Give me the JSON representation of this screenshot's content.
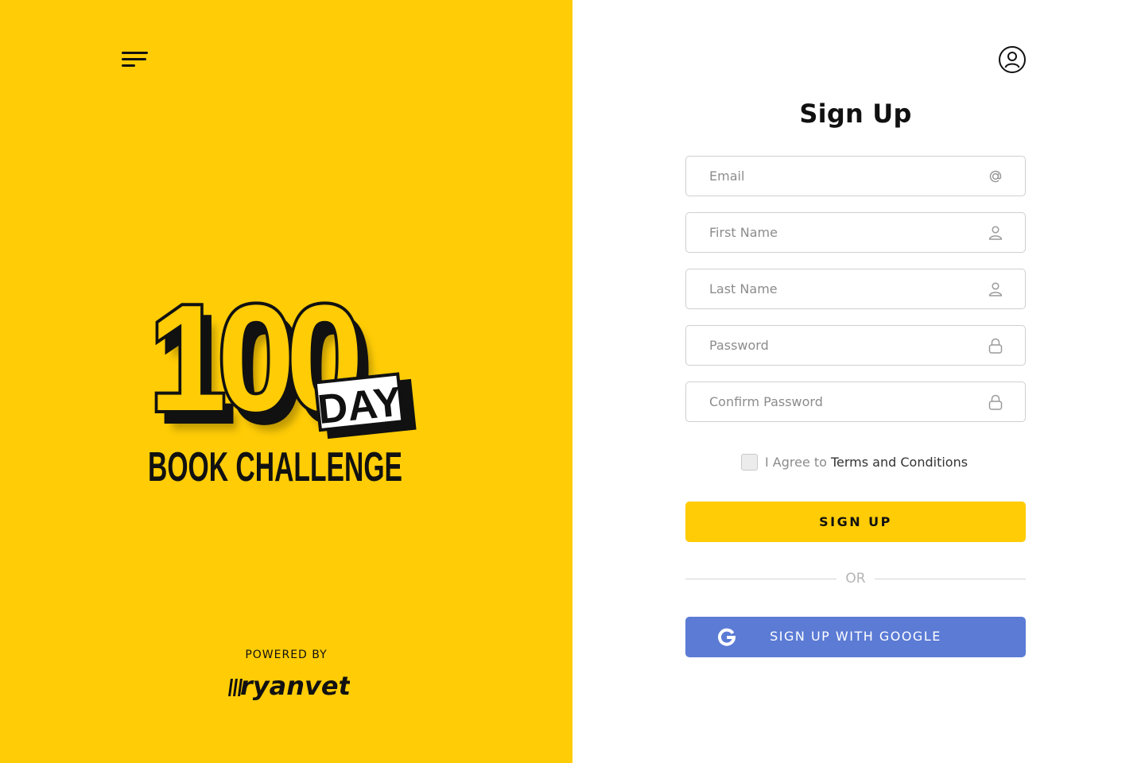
{
  "brand": {
    "logo_text": {
      "number": "100",
      "suffix": "DAY",
      "subtitle": "BOOK CHALLENGE"
    },
    "powered_by": "POWERED BY",
    "partner_logo": "ryanvet",
    "background_color": "#FFCC05"
  },
  "header": {
    "menu_icon": "hamburger-menu-icon",
    "account_icon": "user-circle-icon"
  },
  "form": {
    "title": "Sign Up",
    "fields": [
      {
        "placeholder": "Email",
        "value": "",
        "icon": "at-sign-icon"
      },
      {
        "placeholder": "First Name",
        "value": "",
        "icon": "user-icon"
      },
      {
        "placeholder": "Last Name",
        "value": "",
        "icon": "user-icon"
      },
      {
        "placeholder": "Password",
        "value": "",
        "icon": "lock-icon"
      },
      {
        "placeholder": "Confirm Password",
        "value": "",
        "icon": "lock-icon"
      }
    ],
    "terms": {
      "prefix": "I Agree to",
      "link": "Terms and Conditions",
      "checked": false
    },
    "submit_label": "SIGN UP",
    "divider_label": "OR",
    "google_label": "SIGN UP WITH GOOGLE"
  },
  "colors": {
    "accent": "#FFCC05",
    "google_button": "#5B7BD5",
    "text": "#111111",
    "placeholder": "#8C8C8C"
  }
}
